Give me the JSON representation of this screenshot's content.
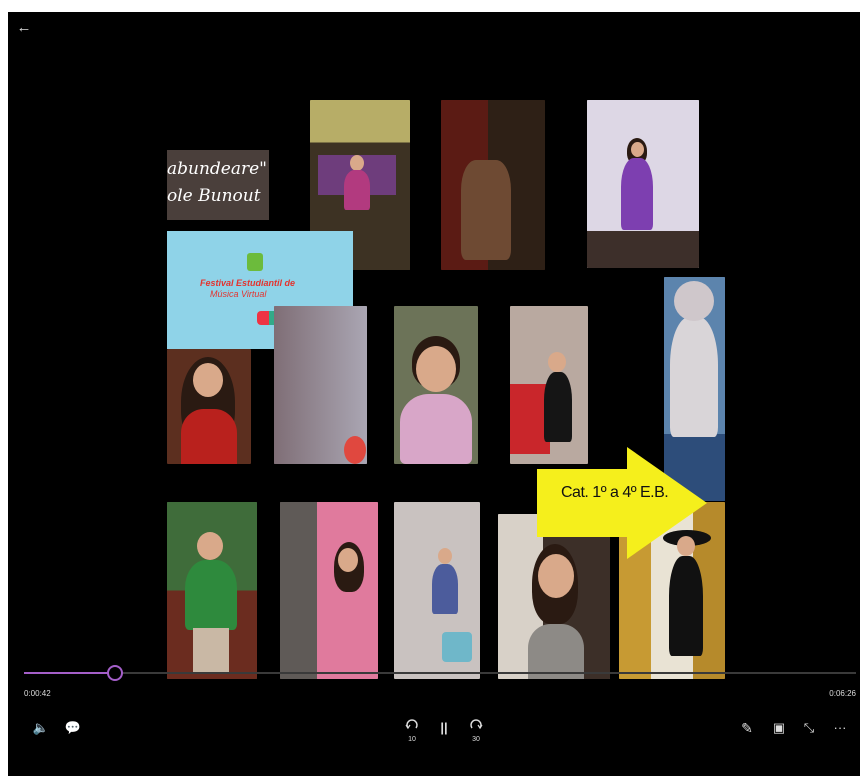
{
  "player": {
    "back_icon": "back-arrow-icon",
    "title_card": {
      "line1": "abundeare\"",
      "line2": "ole Bunout"
    },
    "logo": {
      "line1": "Festival Estudiantil de",
      "line2": "Música Virtual"
    },
    "banner": {
      "text": "Cat. 1º a 4º  E.B."
    },
    "accent_color": "#a45fc9"
  },
  "controls": {
    "progress": {
      "current": "0:00:42",
      "total": "0:06:26",
      "played_fraction": 0.109
    },
    "left_buttons": [
      {
        "name": "volume-button",
        "icon": "speaker-icon",
        "glyph": "🔈"
      },
      {
        "name": "captions-button",
        "icon": "captions-icon",
        "glyph": "💬"
      }
    ],
    "center_buttons": [
      {
        "name": "skip-back-10-button",
        "icon": "rewind-10-icon",
        "label": "10"
      },
      {
        "name": "pause-button",
        "icon": "pause-icon",
        "glyph": "||"
      },
      {
        "name": "skip-forward-30-button",
        "icon": "forward-30-icon",
        "label": "30"
      }
    ],
    "right_buttons": [
      {
        "name": "edit-button",
        "icon": "pencil-icon",
        "glyph": "✎"
      },
      {
        "name": "mini-view-button",
        "icon": "mini-view-icon",
        "glyph": "▣"
      },
      {
        "name": "exit-fullscreen-button",
        "icon": "collapse-icon",
        "glyph": "⤡"
      },
      {
        "name": "more-button",
        "icon": "more-icon",
        "glyph": "···"
      }
    ]
  }
}
